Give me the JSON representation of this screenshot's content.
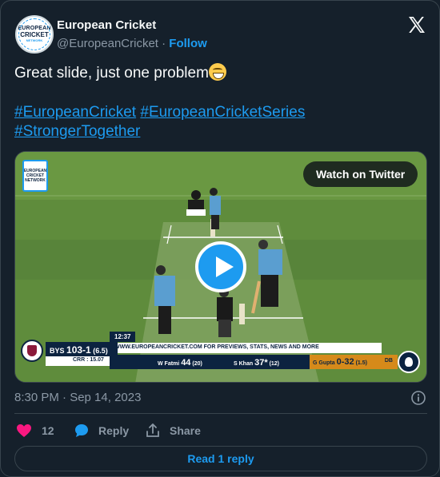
{
  "author": {
    "avatar_text": [
      "EUROPEAN",
      "CRICKET",
      "NETWORK"
    ],
    "name": "European Cricket",
    "handle": "@EuropeanCricket",
    "separator": "·",
    "follow_label": "Follow"
  },
  "tweet": {
    "text": "Great slide, just one problem",
    "emoji": "grinning-face-emoji",
    "hashtags": [
      "#EuropeanCricket",
      "#EuropeanCricketSeries",
      "#StrongerTogether"
    ]
  },
  "media": {
    "watch_label": "Watch on Twitter",
    "corner_logo_text": "EUROPEAN CRICKET NETWORK",
    "overlay": {
      "clock": "12:37",
      "url_strip": "WWW.EUROPEANCRICKET.COM FOR PREVIEWS, STATS, NEWS AND MORE",
      "team": "BYS",
      "score": "103-1",
      "overs": "(6.5)",
      "crr": "CRR : 15.07",
      "batter1_name": "W Fatmi",
      "batter1_runs": "44",
      "batter1_balls": "(20)",
      "batter2_name": "S Khan",
      "batter2_runs": "37*",
      "batter2_balls": "(12)",
      "bowler_name": "G Gupta",
      "bowler_figures": "0-32",
      "bowler_overs": "(1.5)",
      "bowling_team": "DB"
    }
  },
  "meta": {
    "timestamp": "8:30 PM · Sep 14, 2023"
  },
  "actions": {
    "like_count": "12",
    "reply_label": "Reply",
    "share_label": "Share"
  },
  "read_reply_label": "Read 1 reply",
  "colors": {
    "background": "#15202b",
    "accent": "#1d9bf0",
    "like": "#f91880",
    "muted": "#8b98a5",
    "border": "#38444d"
  }
}
